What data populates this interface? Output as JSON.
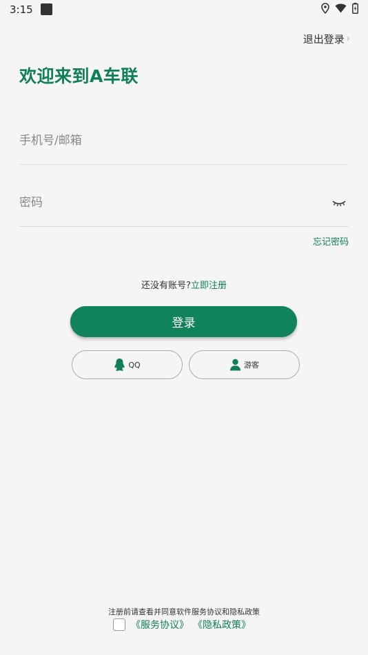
{
  "status_bar": {
    "time": "3:15",
    "icons": [
      "app-notification-icon",
      "location-icon",
      "wifi-icon",
      "battery-icon"
    ]
  },
  "header": {
    "logout_label": "退出登录",
    "logout_chevron": "›",
    "welcome_title": "欢迎来到A车联"
  },
  "form": {
    "phone_placeholder": "手机号/邮箱",
    "phone_value": "",
    "password_placeholder": "密码",
    "password_value": "",
    "forgot_password": "忘记密码"
  },
  "register": {
    "prompt": "还没有账号?",
    "link": "立即注册"
  },
  "buttons": {
    "login": "登录",
    "qq": "QQ",
    "guest": "游客"
  },
  "agreement": {
    "notice": "注册前请查看并同意软件服务协议和隐私政策",
    "service_link": "《服务协议》",
    "privacy_link": "《隐私政策》"
  },
  "colors": {
    "accent": "#0f7f58",
    "background": "#f5f5f5"
  }
}
